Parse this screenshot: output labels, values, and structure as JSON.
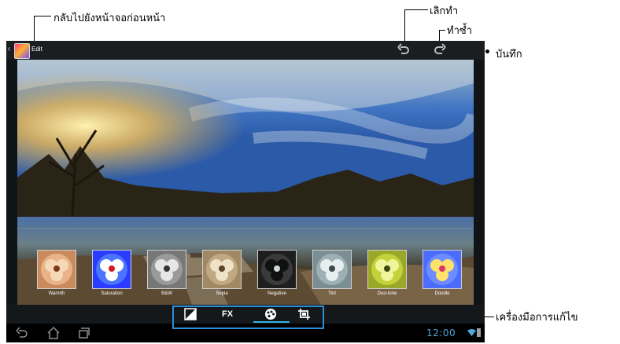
{
  "annotations": {
    "back": "กลับไปยังหน้าจอก่อนหน้า",
    "undo": "เลิกทำ",
    "redo": "ทำซ้ำ",
    "save": "บันทึก",
    "tools": "เครื่องมือการแก้ไข"
  },
  "action_bar": {
    "title": "Edit",
    "back_glyph": "‹",
    "icons": [
      "app-icon",
      "undo-icon",
      "redo-icon"
    ]
  },
  "filters": [
    {
      "name": "Warmth",
      "tint": "#d39a6a"
    },
    {
      "name": "Saturation",
      "tint": "#3b5cff"
    },
    {
      "name": "B&W",
      "tint": "#8c8c8c"
    },
    {
      "name": "Sepia",
      "tint": "#b8a27c"
    },
    {
      "name": "Negative",
      "tint": "#2c2c2c"
    },
    {
      "name": "Tint",
      "tint": "#8fa2a8"
    },
    {
      "name": "Duo-tone",
      "tint": "#b7c23a"
    },
    {
      "name": "Doodle",
      "tint": "#ffd35a"
    }
  ],
  "tools": {
    "fx_label": "FX",
    "items": [
      "auto-fix-icon",
      "fx-effects",
      "color-palette-icon",
      "crop-icon"
    ],
    "active": "color-palette-icon",
    "accent": "#33b5e5"
  },
  "nav_bar": {
    "clock": "12:00",
    "icons": [
      "back-icon",
      "home-icon",
      "recent-apps-icon",
      "wifi-icon",
      "battery-icon"
    ],
    "clock_color": "#4fa6d8"
  }
}
